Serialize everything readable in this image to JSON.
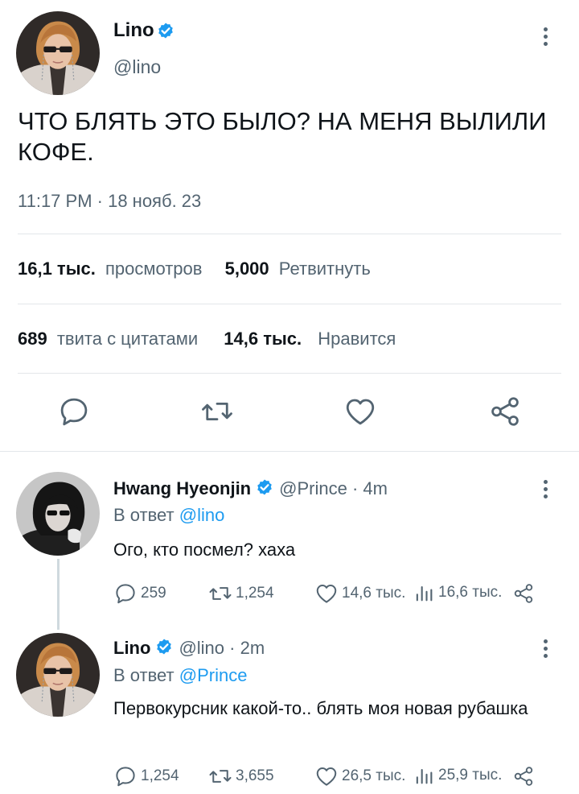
{
  "main": {
    "author": {
      "name": "Lino",
      "handle": "@lino"
    },
    "text": "ЧТО БЛЯТЬ ЭТО БЫЛО? НА МЕНЯ ВЫЛИЛИ КОФЕ.",
    "timestamp": "11:17 PM · 18 нояб. 23",
    "stats": {
      "views_value": "16,1 тыс.",
      "views_label": "просмотров",
      "retweets_value": "5,000",
      "retweets_label": "Ретвитнуть",
      "quotes_value": "689",
      "quotes_label": "твита с цитатами",
      "likes_value": "14,6 тыс.",
      "likes_label": "Нравится"
    },
    "actions": [
      "reply-icon",
      "retweet-icon",
      "like-icon",
      "share-icon"
    ]
  },
  "replies": [
    {
      "name": "Hwang Hyeonjin",
      "handle": "@Prince",
      "time": "· 4m",
      "reply_prefix": "В ответ",
      "reply_to": "@lino",
      "text": "Ого, кто посмел? хаха",
      "replies": "259",
      "retweets": "1,254",
      "likes": "14,6 тыс.",
      "views": "16,6 тыс."
    },
    {
      "name": "Lino",
      "handle": "@lino",
      "time": "· 2m",
      "reply_prefix": "В ответ",
      "reply_to": "@Prince",
      "text": "Первокурсник какой-то.. блять моя новая рубашка",
      "replies": "1,254",
      "retweets": "3,655",
      "likes": "26,5 тыс.",
      "views": "25,9 тыс."
    }
  ],
  "colors": {
    "accent": "#1d9bf0",
    "text": "#0f1419",
    "muted": "#536471",
    "divider": "#e3e7ea"
  }
}
